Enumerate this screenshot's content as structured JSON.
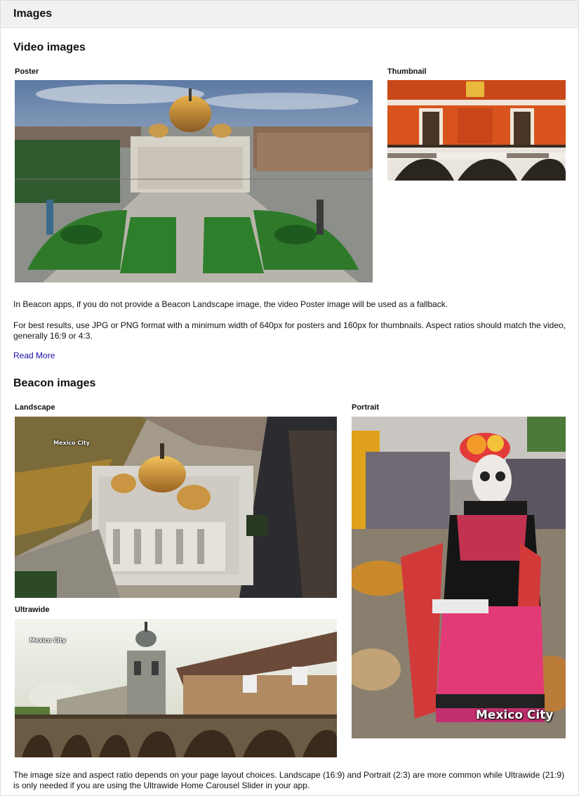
{
  "panel": {
    "title": "Images"
  },
  "video_section": {
    "heading": "Video images",
    "poster_label": "Poster",
    "poster_image": "palace-of-fine-arts-aerial-photo",
    "thumbnail_label": "Thumbnail",
    "thumbnail_image": "orange-tiled-building-facade-photo",
    "paragraph_1": "In Beacon apps, if you do not provide a Beacon Landscape image, the video Poster image will be used as a fallback.",
    "paragraph_2": "For best results, use JPG or PNG format with a minimum width of 640px for posters and 160px for thumbnails. Aspect ratios should match the video, generally 16:9 or 4:3.",
    "read_more": "Read More"
  },
  "beacon_section": {
    "heading": "Beacon images",
    "landscape_label": "Landscape",
    "landscape_image": "palace-dome-aerial-photo",
    "landscape_overlay": "Mexico City",
    "portrait_label": "Portrait",
    "portrait_image": "catrina-costume-photo",
    "portrait_overlay": "Mexico City",
    "ultrawide_label": "Ultrawide",
    "ultrawide_image": "colonial-church-photo",
    "ultrawide_overlay": "Mexico City",
    "paragraph": "The image size and aspect ratio depends on your page layout choices. Landscape (16:9) and Portrait (2:3) are more common while Ultrawide (21:9) is only needed if you are using the Ultrawide Home Carousel Slider in your app."
  }
}
